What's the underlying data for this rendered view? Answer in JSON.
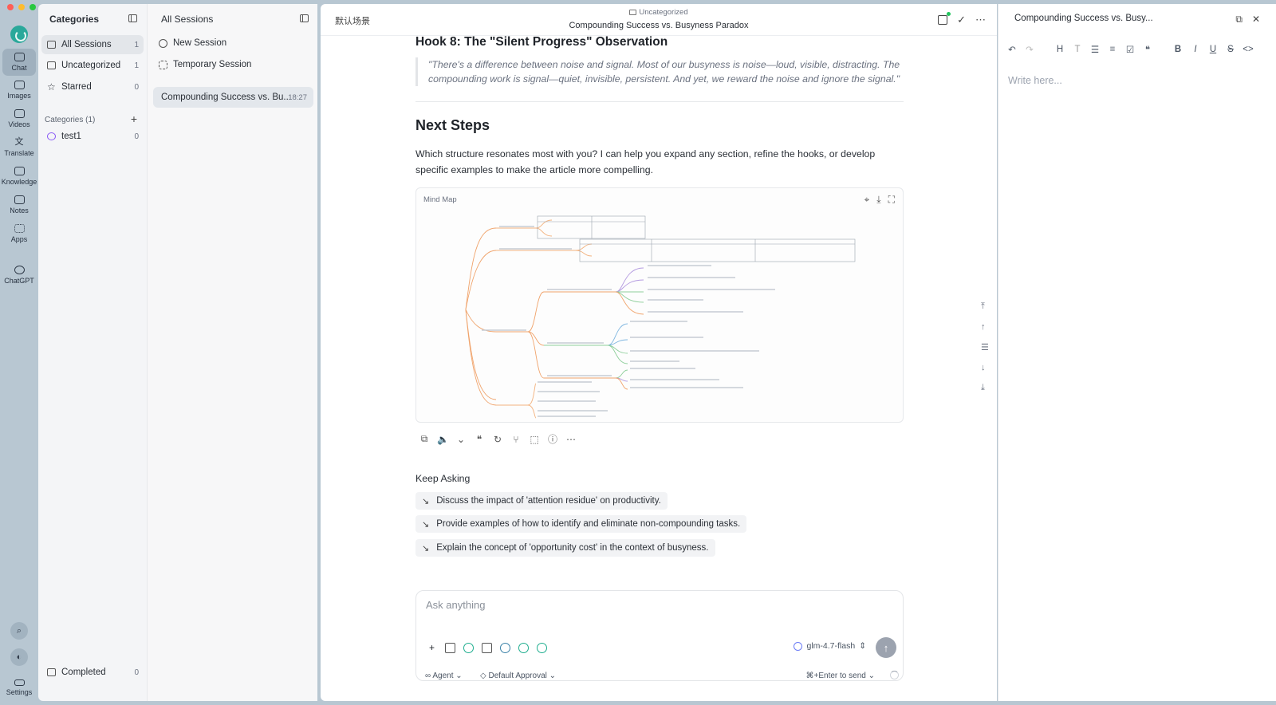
{
  "rail": {
    "items": [
      {
        "label": "Chat",
        "icon": "chat-icon",
        "active": true
      },
      {
        "label": "Images",
        "icon": "image-icon"
      },
      {
        "label": "Videos",
        "icon": "video-icon"
      },
      {
        "label": "Translate",
        "icon": "translate-icon"
      },
      {
        "label": "Knowledge",
        "icon": "knowledge-icon"
      },
      {
        "label": "Notes",
        "icon": "notes-icon"
      },
      {
        "label": "Apps",
        "icon": "apps-icon"
      },
      {
        "label": "ChatGPT",
        "icon": "chatgpt-icon"
      }
    ],
    "settings_label": "Settings"
  },
  "categories": {
    "title": "Categories",
    "items": [
      {
        "label": "All Sessions",
        "count": "1"
      },
      {
        "label": "Uncategorized",
        "count": "1"
      },
      {
        "label": "Starred",
        "count": "0"
      }
    ],
    "section_label": "Categories (1)",
    "user_categories": [
      {
        "label": "test1",
        "count": "0"
      }
    ],
    "completed": {
      "label": "Completed",
      "count": "0"
    }
  },
  "sessions": {
    "title": "All Sessions",
    "new_session": "New Session",
    "temporary_session": "Temporary Session",
    "list": [
      {
        "title": "Compounding Success vs. Bu...",
        "time": "18:27"
      }
    ]
  },
  "main": {
    "scene": "默认场景",
    "breadcrumb": "Uncategorized",
    "title": "Compounding Success vs. Busyness Paradox",
    "hook_heading": "Hook 8: The \"Silent Progress\" Observation",
    "quote": "\"There's a difference between noise and signal. Most of our busyness is noise—loud, visible, distracting. The compounding work is signal—quiet, invisible, persistent. And yet, we reward the noise and ignore the signal.\"",
    "next_heading": "Next Steps",
    "paragraph": "Which structure resonates most with you? I can help you expand any section, refine the hooks, or develop specific examples to make the article more compelling.",
    "mindmap_title": "Mind Map",
    "keep_asking": "Keep Asking",
    "suggestions": [
      "Discuss the impact of 'attention residue' on productivity.",
      "Provide examples of how to identify and eliminate non-compounding tasks.",
      "Explain the concept of 'opportunity cost' in the context of busyness."
    ]
  },
  "composer": {
    "placeholder": "Ask anything",
    "model": "glm-4.7-flash",
    "agent": "Agent",
    "approval": "Default Approval",
    "send_hint": "⌘+Enter to send"
  },
  "notes": {
    "title": "Compounding Success vs. Busy...",
    "placeholder": "Write here..."
  },
  "colors": {
    "accent": "#2aa89a",
    "mindmap_orange": "#f0a36b",
    "mindmap_blue": "#7fb6e0",
    "mindmap_green": "#8fcf9b",
    "mindmap_purple": "#b49be0"
  }
}
